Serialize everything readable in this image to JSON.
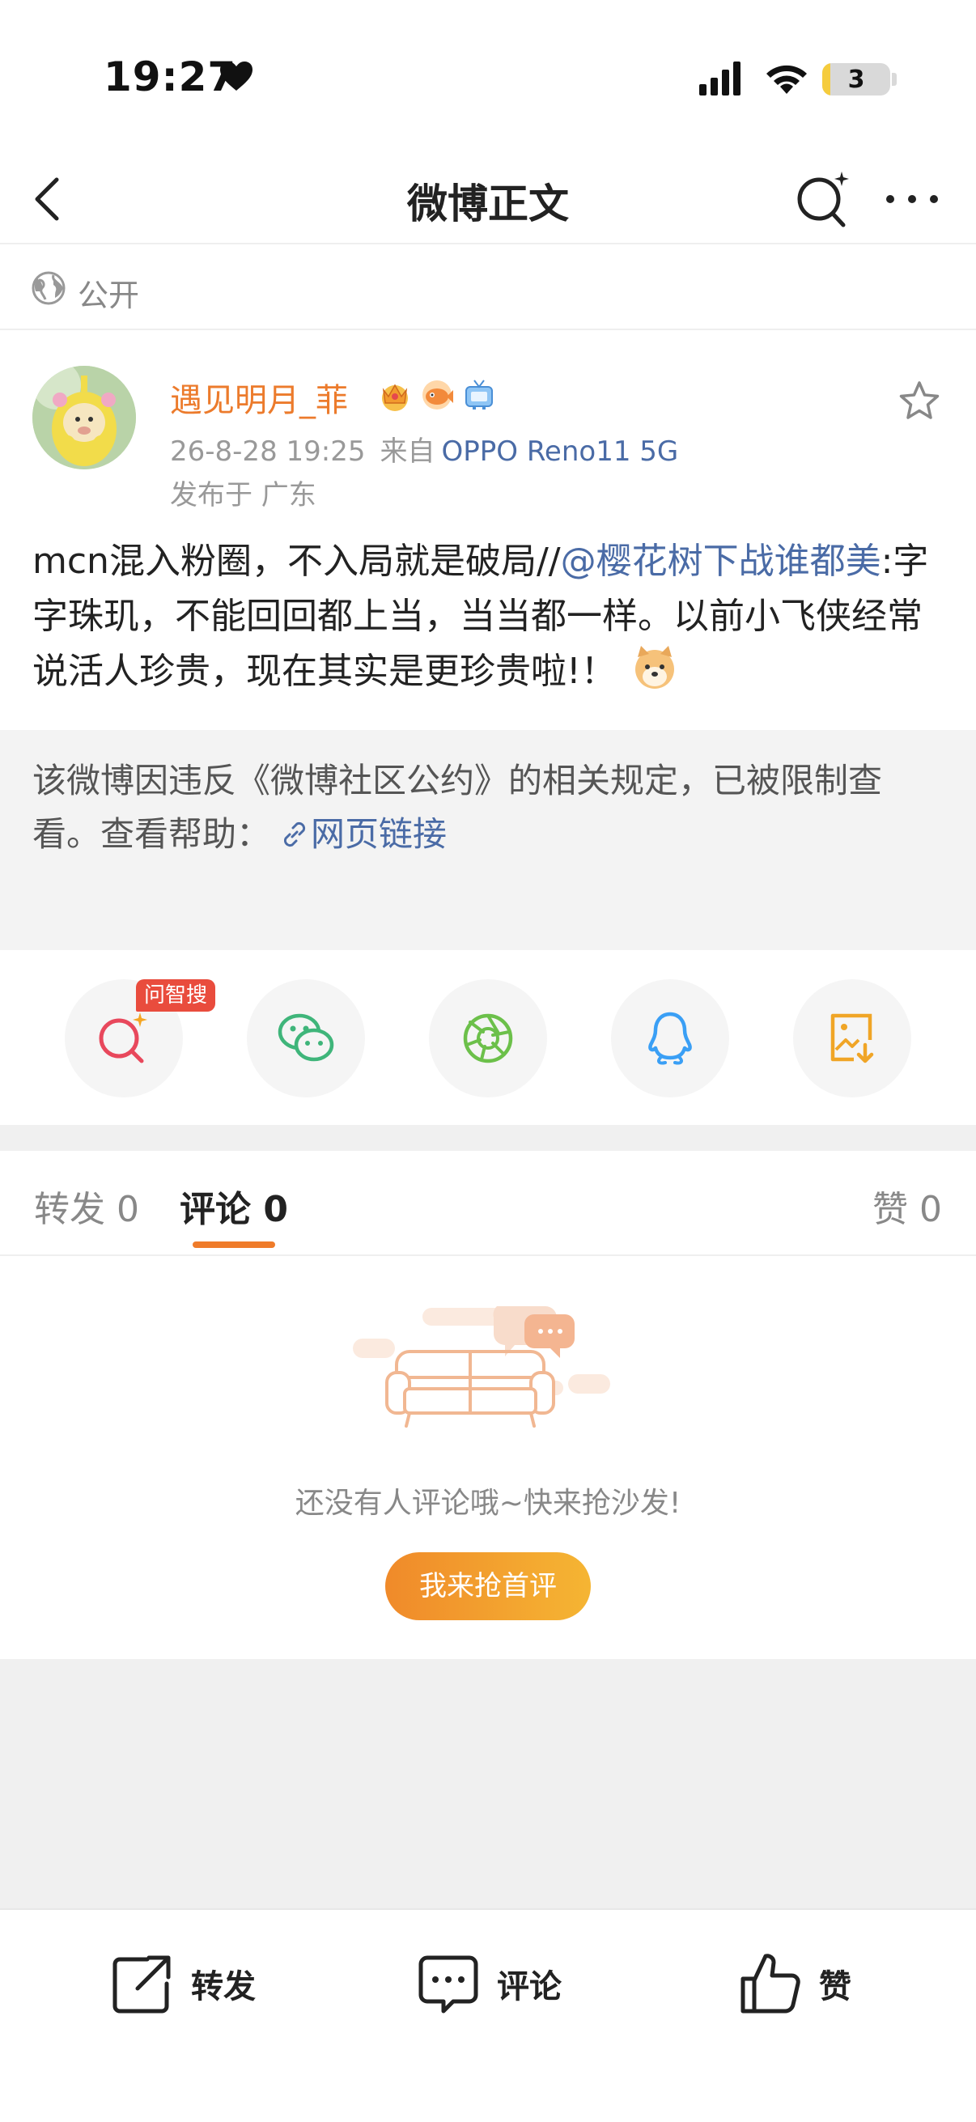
{
  "status_bar": {
    "time": "19:27",
    "battery": "3",
    "icons": [
      "heart-icon",
      "signal-icon",
      "wifi-icon",
      "battery-icon"
    ]
  },
  "nav": {
    "title": "微博正文",
    "icons": [
      "back-icon",
      "ai-search-icon",
      "more-icon"
    ]
  },
  "visibility": {
    "label": "公开",
    "icon": "globe-icon"
  },
  "post": {
    "username": "遇见明月_菲",
    "username_color": "#ec7b2c",
    "badges": [
      "crown-badge-icon",
      "fish-badge-icon",
      "tv-badge-icon"
    ],
    "date": "26-8-28 19:25",
    "source_prefix": "来自",
    "source_device": "OPPO Reno11 5G",
    "location": "发布于 广东",
    "body_prefix": "mcn混入粉圈，不入局就是破局//",
    "mention": "@樱花树下战谁都美",
    "body_suffix": ":字字珠玑，不能回回都上当，当当都一样。以前小飞侠经常说活人珍贵，现在其实是更珍贵啦!！",
    "link_color": "#4a6ba6"
  },
  "restricted": {
    "text": "该微博因违反《微博社区公约》的相关规定，已被限制查看。查看帮助：",
    "link_label": "网页链接"
  },
  "share": {
    "ask_tag": "问智搜",
    "items": [
      "ai-ask-icon",
      "wechat-icon",
      "moments-icon",
      "qq-icon",
      "save-image-icon"
    ]
  },
  "tabs": {
    "repost": "转发 0",
    "comment": "评论 0",
    "like": "赞 0",
    "accent": "#ef7b2a"
  },
  "empty_state": {
    "text": "还没有人评论哦~快来抢沙发!",
    "button": "我来抢首评"
  },
  "bottom_bar": {
    "repost": "转发",
    "comment": "评论",
    "like": "赞"
  }
}
